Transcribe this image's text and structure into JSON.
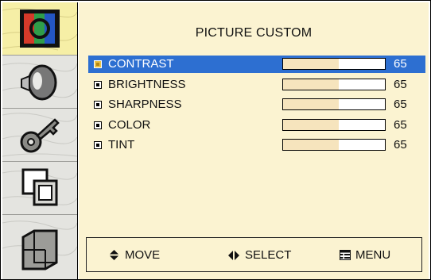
{
  "sidebar": {
    "items": [
      {
        "icon": "picture-icon",
        "active": true
      },
      {
        "icon": "sound-icon",
        "active": false
      },
      {
        "icon": "key-icon",
        "active": false
      },
      {
        "icon": "pip-icon",
        "active": false
      },
      {
        "icon": "setup-icon",
        "active": false
      }
    ]
  },
  "panel": {
    "title": "PICTURE CUSTOM",
    "settings": [
      {
        "label": "CONTRAST",
        "value": "65",
        "level_percent": 55,
        "selected": true
      },
      {
        "label": "BRIGHTNESS",
        "value": "65",
        "level_percent": 55,
        "selected": false
      },
      {
        "label": "SHARPNESS",
        "value": "65",
        "level_percent": 55,
        "selected": false
      },
      {
        "label": "COLOR",
        "value": "65",
        "level_percent": 55,
        "selected": false
      },
      {
        "label": "TINT",
        "value": "65",
        "level_percent": 55,
        "selected": false
      }
    ]
  },
  "footer": {
    "move_label": "MOVE",
    "select_label": "SELECT",
    "menu_label": "MENU"
  },
  "colors": {
    "panel_bg": "#fbf3d1",
    "selected_row": "#2d6fd1",
    "bar_fill": "#f6e4bd",
    "active_sidebar": "#f6efa6"
  }
}
